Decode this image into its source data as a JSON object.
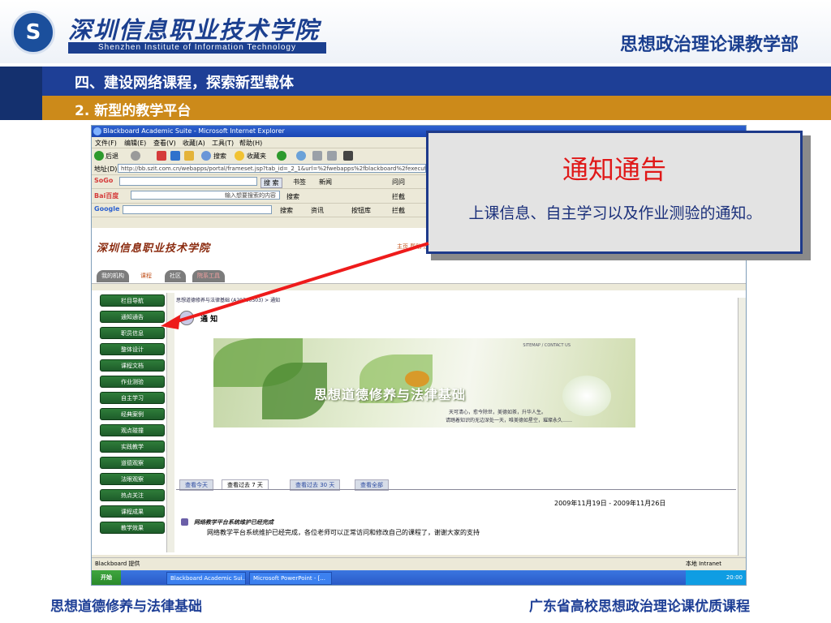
{
  "slide": {
    "school_cn": "深圳信息职业技术学院",
    "school_en": "Shenzhen Institute of Information Technology",
    "dept": "思想政治理论课教学部",
    "section": "四、建设网络课程，探索新型载体",
    "subsection": "2.  新型的教学平台",
    "footer_left": "思想道德修养与法律基础",
    "footer_right": "广东省高校思想政治理论课优质课程"
  },
  "callout": {
    "title": "通知通告",
    "body": "上课信息、自主学习以及作业测验的通知。"
  },
  "browser": {
    "title": "Blackboard Academic Suite - Microsoft Internet Explorer",
    "menu": [
      "文件(F)",
      "编辑(E)",
      "查看(V)",
      "收藏(A)",
      "工具(T)",
      "帮助(H)"
    ],
    "toolbar": {
      "back": "后退",
      "search": "搜索",
      "favorites": "收藏夹"
    },
    "address_label": "地址(D)",
    "address": "http://bb.szit.com.cn/webapps/portal/frameset.jsp?tab_id=_2_1&url=%2fwebapps%2fblackboard%2fexecute%2flaun",
    "sogou": {
      "search": "搜 索",
      "bookmark": "书签",
      "news": "新闻",
      "ask": "问问"
    },
    "baidu": {
      "placeholder": "输入想要搜索的内容",
      "search": "搜索",
      "blog": "拦截"
    },
    "google": {
      "search": "搜索",
      "news": "资讯",
      "lib": "按钮库",
      "block": "拦截"
    },
    "status": "Blackboard 提供",
    "zone": "本地 Intranet"
  },
  "portal": {
    "title": "深圳信息职业技术学院",
    "tabs": [
      "我的机构",
      "课程",
      "社区",
      "院系工具"
    ],
    "top_links": "主页  帮助  注销",
    "breadcrumb": "思想道德修养与法律基础 (A20700503) > 通知",
    "notice_label": "通 知",
    "nav": [
      "栏目导航",
      "通知通告",
      "职员信息",
      "整体设计",
      "课程文档",
      "作业测验",
      "自主学习",
      "经典案例",
      "观点碰撞",
      "实践教学",
      "道德观察",
      "法眼观察",
      "热点关注",
      "课程成果",
      "教学效果"
    ],
    "banner_title": "思想道德修养与法律基础",
    "banner_sub1": "天可清心，愈今除世，美德如茶，升华人生。",
    "banner_sub2": "请踏着知识的无边深处一天，唯美德如星空，璀璨永久……",
    "banner_corner": "SITEMAP / CONTACT US",
    "view_tabs": [
      "查看今天",
      "查看过去 7 天",
      "查看过去 30 天",
      "查看全部"
    ],
    "date_range": "2009年11月19日  - 2009年11月26日",
    "post_title": "网络教学平台系统维护已经完成",
    "post_body": "网络教学平台系统维护已经完成，各位老师可以正常访问和修改自己的课程了，谢谢大家的支持"
  },
  "taskbar": {
    "start": "开始",
    "items": [
      "Blackboard Academic Sui...",
      "Microsoft PowerPoint - [..."
    ],
    "clock": "20:00"
  },
  "colors": {
    "navy": "#1e3f96",
    "orange": "#cc8a1a",
    "red": "#e01818",
    "nav_green": "#2f7d3a"
  }
}
